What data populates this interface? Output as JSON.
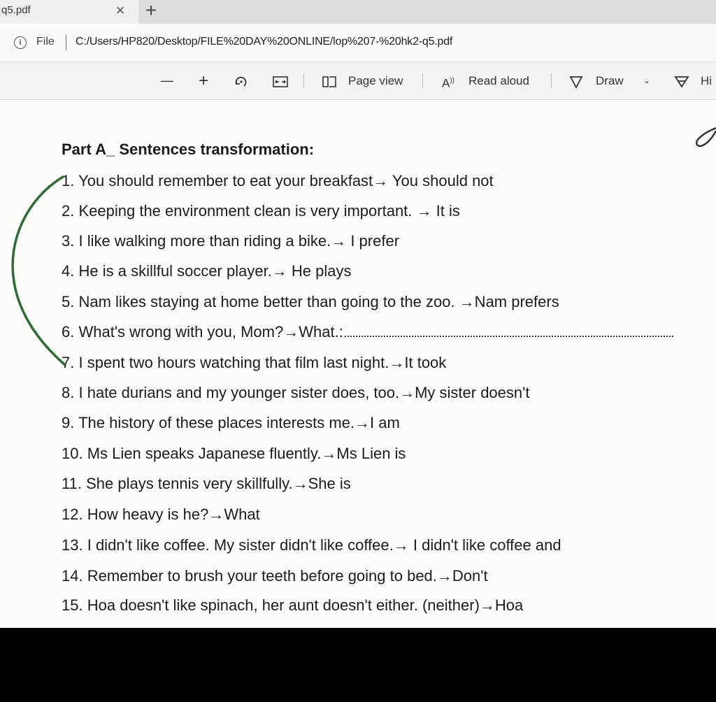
{
  "browser": {
    "tab_title": "q5.pdf",
    "close_glyph": "×",
    "new_tab_glyph": "+",
    "scheme": "File",
    "url": "C:/Users/HP820/Desktop/FILE%20DAY%20ONLINE/lop%207-%20hk2-q5.pdf"
  },
  "toolbar": {
    "zoom_out": "—",
    "zoom_in": "+",
    "page_view": "Page view",
    "read_aloud": "Read aloud",
    "draw": "Draw",
    "highlight": "Hi"
  },
  "document": {
    "heading": "Part A_ Sentences transformation:",
    "items": [
      {
        "num": "1.",
        "text": "You should remember to eat your breakfast→ You should not"
      },
      {
        "num": "2.",
        "text": "Keeping the environment clean is very important. → It is"
      },
      {
        "num": "3.",
        "text": "I like walking more than riding a bike.→ I prefer"
      },
      {
        "num": "4.",
        "text": "He is a skillful soccer player.→ He plays"
      },
      {
        "num": "5.",
        "text": "Nam likes staying at home better than going to the zoo. →Nam prefers"
      },
      {
        "num": "6.",
        "text": "What's wrong with you, Mom?→What.:"
      },
      {
        "num": "7.",
        "text": "I spent two hours watching that film last night.→It took"
      },
      {
        "num": "8.",
        "text": "I hate durians and my younger sister does, too.→My sister doesn't"
      },
      {
        "num": "9.",
        "text": "The history of these places interests me.→I am"
      },
      {
        "num": "10.",
        "text": "Ms Lien speaks Japanese fluently.→Ms Lien is"
      },
      {
        "num": "11.",
        "text": "She plays tennis very skillfully.→She is"
      },
      {
        "num": "12.",
        "text": "How heavy is he?→What"
      },
      {
        "num": "13.",
        "text": "I didn't like coffee. My sister didn't like coffee.→ I didn't like coffee and"
      },
      {
        "num": "14.",
        "text": "Remember to brush your teeth before going to bed.→Don't"
      },
      {
        "num": "15.",
        "text": "Hoa doesn't like spinach, her aunt doesn't either. (neither)→Hoa"
      }
    ]
  },
  "colors": {
    "annotation_ink": "#2e6b34",
    "text": "#1c1c1c"
  }
}
